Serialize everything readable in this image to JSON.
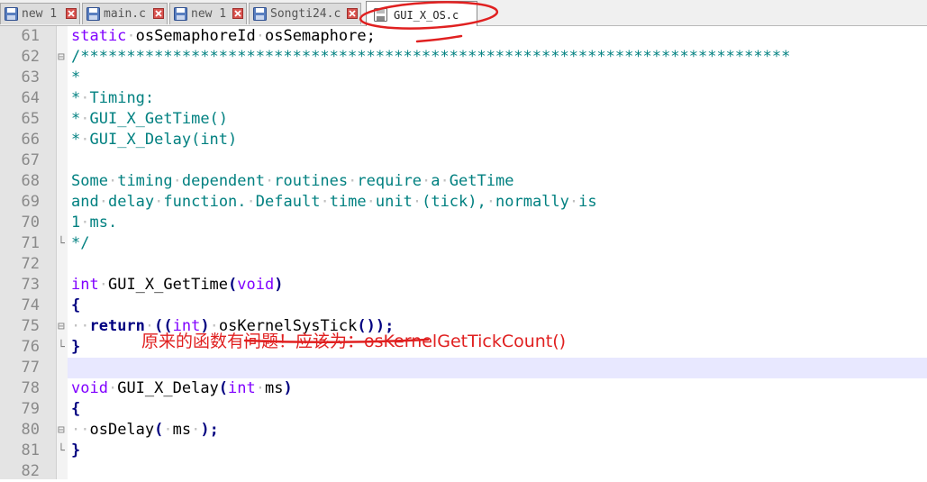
{
  "tabs": [
    {
      "label": "new 1",
      "active": false
    },
    {
      "label": "main.c",
      "active": false
    },
    {
      "label": "new 1",
      "active": false
    },
    {
      "label": "Songti24.c",
      "active": false
    },
    {
      "label": "GUI_X_OS.c",
      "active": true
    }
  ],
  "editor": {
    "line_numbers": [
      "61",
      "62",
      "63",
      "64",
      "65",
      "66",
      "67",
      "68",
      "69",
      "70",
      "71",
      "72",
      "73",
      "74",
      "75",
      "76",
      "77",
      "78",
      "79",
      "80",
      "81",
      "82"
    ],
    "lines": {
      "l61": {
        "kw": "static",
        "rest": "osSemaphoreId",
        "rest2": "osSemaphore;"
      },
      "l62": "/*****************************************************************************",
      "l63": "*",
      "l64": "Timing:",
      "l65": "GUI_X_GetTime()",
      "l66": "GUI_X_Delay(int)",
      "l68": [
        "Some",
        "timing",
        "dependent",
        "routines",
        "require",
        "a",
        "GetTime"
      ],
      "l69": [
        "and",
        "delay",
        "function.",
        "Default",
        "time",
        "unit",
        "(tick),",
        "normally",
        "is"
      ],
      "l70": [
        "1",
        "ms."
      ],
      "l71": "*/",
      "l73": {
        "type": "int",
        "name": "GUI_X_GetTime",
        "param": "void"
      },
      "l75": {
        "keyword": "return",
        "cast": "int",
        "call": "osKernelSysTick"
      },
      "l78": {
        "type": "void",
        "name": "GUI_X_Delay",
        "ptype": "int",
        "pname": "ms"
      },
      "l80": {
        "call": "osDelay",
        "arg": "ms"
      }
    },
    "current_line": "77"
  },
  "annotation": {
    "text": "原来的函数有问题！应该为：osKernelGetTickCount()",
    "color": "#e02020"
  },
  "colors": {
    "comment": "#008080",
    "type_keyword": "#8000ff",
    "bold_keyword": "#000080",
    "line_number": "#8a8a8a",
    "gutter": "#e4e4e4",
    "current_line_bg": "#e8e8ff"
  }
}
